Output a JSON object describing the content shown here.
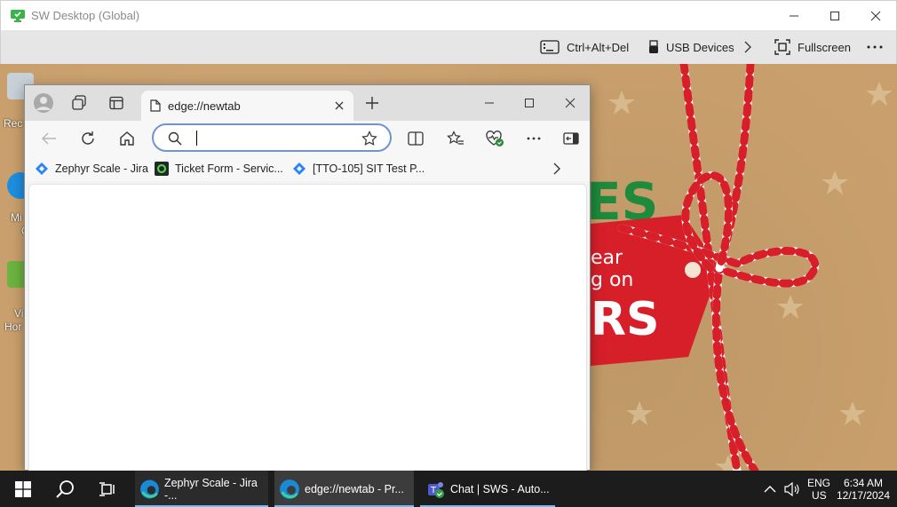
{
  "outer_window": {
    "title": "SW Desktop (Global)"
  },
  "sw_toolbar": {
    "ctrl_alt_del": "Ctrl+Alt+Del",
    "usb_devices": "USB Devices",
    "fullscreen": "Fullscreen"
  },
  "desktop": {
    "icons": [
      {
        "label": "Rec"
      },
      {
        "label": "Mi"
      },
      {
        "label": "C"
      },
      {
        "label": "Vi"
      },
      {
        "label": "Hor"
      }
    ],
    "wallpaper": {
      "tag_text_1": "ES",
      "tag_text_2": "ear",
      "tag_text_3": "g on",
      "tag_text_4": "RS"
    }
  },
  "browser": {
    "tab": {
      "title": "edge://newtab"
    },
    "address": {
      "value": "",
      "placeholder": ""
    },
    "favorites": [
      {
        "label": "Zephyr Scale - Jira",
        "icon": "jira-icon"
      },
      {
        "label": "Ticket Form - Servic...",
        "icon": "servicenow-icon"
      },
      {
        "label": "[TTO-105] SIT Test P...",
        "icon": "jira-icon"
      }
    ]
  },
  "taskbar": {
    "apps": [
      {
        "label": "Zephyr Scale - Jira -...",
        "icon": "edge-icon",
        "active": false
      },
      {
        "label": "edge://newtab - Pr...",
        "icon": "edge-icon",
        "active": true
      },
      {
        "label": "Chat | SWS - Auto...",
        "icon": "teams-icon",
        "active": false
      }
    ],
    "tray": {
      "lang": "ENG",
      "region": "US",
      "time": "6:34 AM",
      "date": "12/17/2024"
    }
  },
  "colors": {
    "accent": "#76b9ed",
    "address_border": "#6f94d6",
    "desktop_bg": "#c9a06d",
    "taskbar_bg": "#1c1c1c"
  }
}
